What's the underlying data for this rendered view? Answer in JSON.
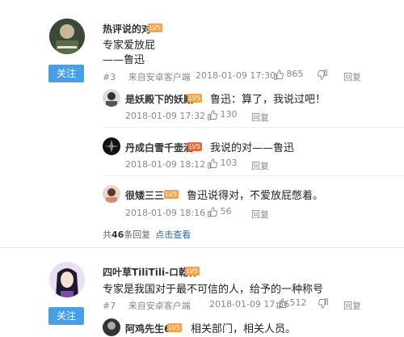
{
  "comments": [
    {
      "username": "热评说的对",
      "level": "LV5",
      "text_lines": [
        "专家爱放屁",
        "——鲁迅"
      ],
      "floor": "#3",
      "source": "来自安卓客户端",
      "time": "2018-01-09 17:30",
      "likes": "865",
      "reply": "回复",
      "follow_label": "关注",
      "replies": [
        {
          "username": "是妖殿下的妖殿",
          "level": "LV5",
          "text": "鲁迅：算了，我说过吧！",
          "time": "2018-01-09 17:32",
          "likes": "130",
          "reply": "回复"
        },
        {
          "username": "丹成白雪千壶酒",
          "level": "LV5",
          "text": "我说的对——鲁迅",
          "time": "2018-01-09 18:12",
          "likes": "103",
          "reply": "回复"
        },
        {
          "username": "很矮三三",
          "level": "LV5",
          "text": "鲁迅说得对，不爱放屁憋着。",
          "time": "2018-01-09 18:16",
          "likes": "56",
          "reply": "回复"
        }
      ],
      "reply_summary": {
        "prefix": "共",
        "count": "46",
        "suffix": "条回复",
        "link": "点击查看"
      }
    },
    {
      "username": "四叶草TiliTili-ロ乾杯",
      "level": "LV5",
      "text": "专家是我国对于最不可信的人，给予的一种称号",
      "floor": "#7",
      "source": "来自安卓客户端",
      "time": "2018-01-09 17:36",
      "likes": "512",
      "reply": "回复",
      "follow_label": "关注",
      "replies": [
        {
          "username": "阿鸡先生6",
          "level": "LV5",
          "text": "相关部门，相关人员。"
        }
      ]
    }
  ],
  "colors": {
    "accent": "#4a9fe4",
    "link": "#2d6ab1",
    "level_badge": "#f7a14a"
  },
  "icons": {
    "like": "thumbs-up-icon",
    "dislike": "thumbs-down-icon"
  }
}
